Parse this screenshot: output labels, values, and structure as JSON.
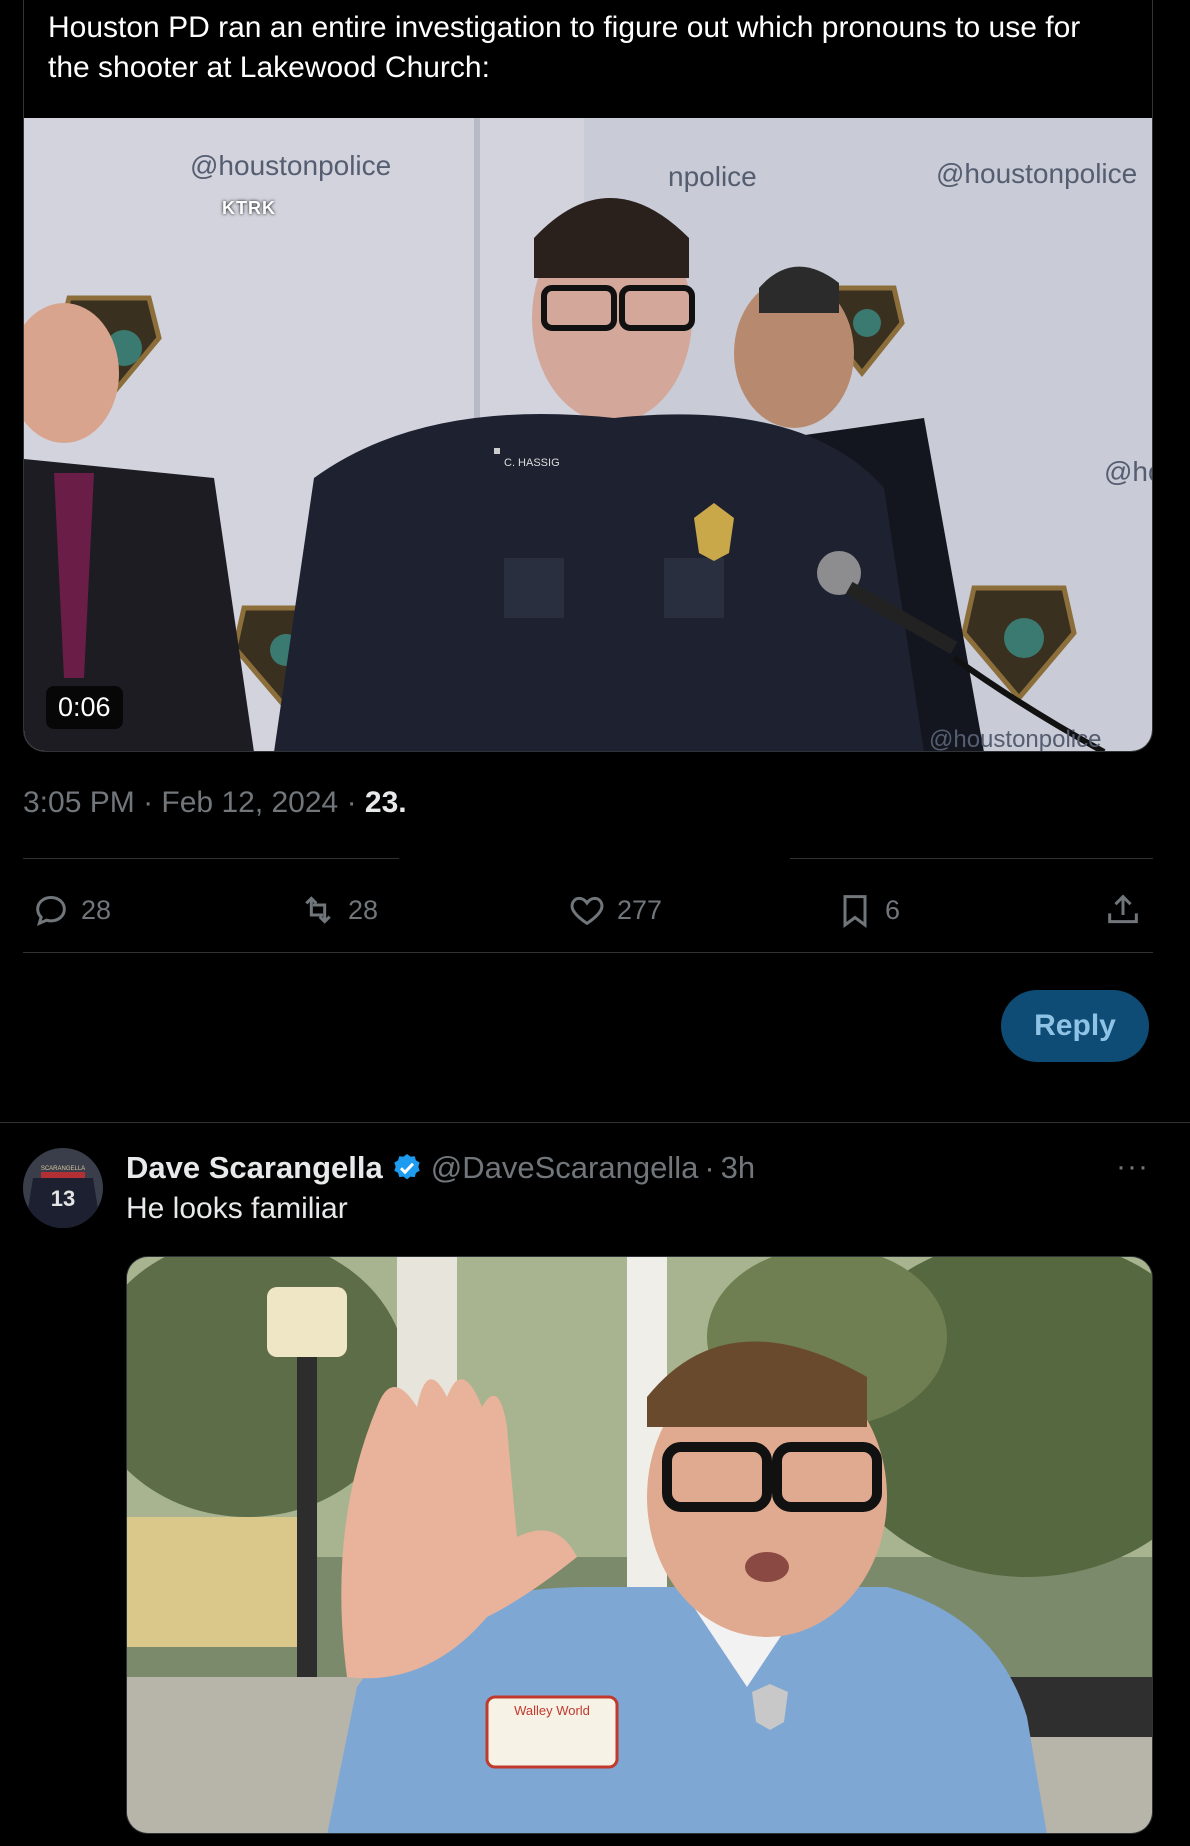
{
  "quoted_tweet": {
    "text_line1": "Houston PD ran an entire investigation to figure out which pronouns to use for",
    "text_line2": "the shooter at Lakewood Church:",
    "video": {
      "duration": "0:06",
      "watermark": "KTRK",
      "wall_handle_left": "@houstonpolice",
      "wall_handle_center": "npolice",
      "wall_handle_right": "@houstonpolice",
      "wall_handle_edge": "@ho",
      "wall_handle_bottom": "@houstonpolice",
      "name_tag": "C. HASSIG"
    }
  },
  "meta": {
    "time": "3:05 PM",
    "date": "Feb 12, 2024",
    "views": "23.",
    "sep": "·"
  },
  "actions": {
    "replies": "28",
    "reposts": "28",
    "likes": "277",
    "bookmarks": "6"
  },
  "reply_button": {
    "label": "Reply"
  },
  "reply": {
    "author_name": "Dave Scarangella",
    "author_handle": "@DaveScarangella",
    "age": "3h",
    "text": "He looks familiar",
    "more": "···",
    "avatar_jersey": "SCARANGELLA",
    "avatar_number": "13",
    "image_patch": "Walley World"
  },
  "colors": {
    "background": "#000000",
    "divider": "#2f3336",
    "muted": "#71767b",
    "reply_button_bg": "#0e4c75",
    "verified": "#1d9bf0"
  }
}
